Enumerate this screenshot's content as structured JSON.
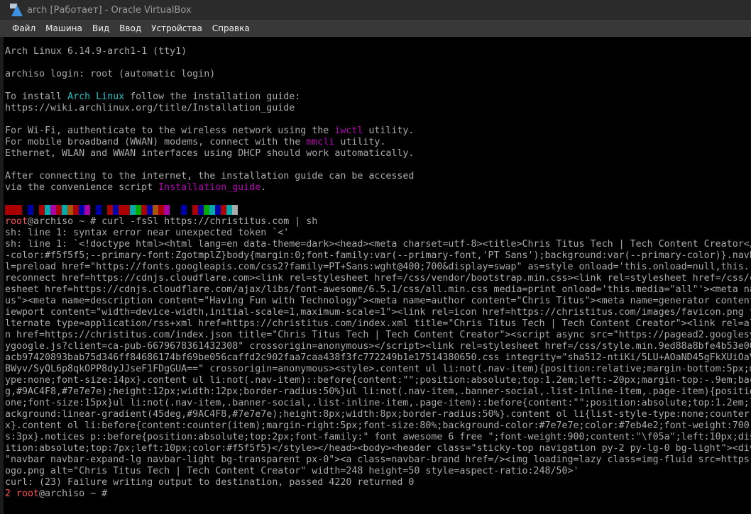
{
  "window": {
    "title": "arch [Работает] - Oracle VirtualBox",
    "menu": [
      "Файл",
      "Машина",
      "Вид",
      "Ввод",
      "Устройства",
      "Справка"
    ]
  },
  "colors": {
    "text": "#aaaaaa",
    "cyan": "#22c0c0",
    "magenta": "#b000b0",
    "prompt_red": "#ff5555",
    "palette": {
      "r": "#aa0000",
      "b": "#0000aa",
      "c": "#00aaaa",
      "m": "#aa00aa",
      "o": "#aa5500",
      "g": "#00aa00",
      "w": "#aaaaaa",
      "k": "#000000"
    }
  },
  "color_bar": [
    "r",
    "r",
    "r",
    "k",
    "b",
    "k",
    "r",
    "c",
    "m",
    "r",
    "c",
    "o",
    "r",
    "b",
    "m",
    "k",
    "b",
    "k",
    "r",
    "b",
    "r",
    "r",
    "c",
    "g",
    "r",
    "b",
    "o",
    "r",
    "m",
    "k",
    "k",
    "b",
    "k",
    "r",
    "b",
    "g",
    "c",
    "b",
    "r",
    "c",
    "w"
  ],
  "terminal": {
    "lines": [
      {
        "segments": [
          {
            "text": "Arch Linux 6.14.9-arch1-1 (tty1)"
          }
        ]
      },
      {
        "segments": []
      },
      {
        "segments": [
          {
            "text": "archiso login: root (automatic login)"
          }
        ]
      },
      {
        "segments": []
      },
      {
        "segments": [
          {
            "text": "To install "
          },
          {
            "text": "Arch Linux",
            "color": "cyan"
          },
          {
            "text": " follow the installation guide:"
          }
        ]
      },
      {
        "segments": [
          {
            "text": "https://wiki.archlinux.org/title/Installation_guide"
          }
        ]
      },
      {
        "segments": []
      },
      {
        "segments": [
          {
            "text": "For Wi-Fi, authenticate to the wireless network using the "
          },
          {
            "text": "iwctl",
            "color": "magenta"
          },
          {
            "text": " utility."
          }
        ]
      },
      {
        "segments": [
          {
            "text": "For mobile broadband (WWAN) modems, connect with the "
          },
          {
            "text": "mmcli",
            "color": "magenta"
          },
          {
            "text": " utility."
          }
        ]
      },
      {
        "segments": [
          {
            "text": "Ethernet, WLAN and WWAN interfaces using DHCP should work automatically."
          }
        ]
      },
      {
        "segments": []
      },
      {
        "segments": [
          {
            "text": "After connecting to the internet, the installation guide can be accessed"
          }
        ]
      },
      {
        "segments": [
          {
            "text": "via the convenience script "
          },
          {
            "text": "Installation_guide",
            "color": "magenta"
          },
          {
            "text": "."
          }
        ]
      },
      {
        "segments": []
      },
      {
        "colorbar": true,
        "segments": []
      },
      {
        "segments": [
          {
            "text": "root",
            "color": "prompt_red"
          },
          {
            "text": "@archiso ~ # curl -fsSl https://christitus.com | sh"
          }
        ]
      },
      {
        "segments": [
          {
            "text": "sh: line 1: syntax error near unexpected token `<'"
          }
        ]
      },
      {
        "segments": [
          {
            "text": "sh: line 1: `<!doctype html><html lang=en data-theme=dark><head><meta charset=utf-8><title>Chris Titus Tech | Tech Content Creator</"
          }
        ]
      },
      {
        "segments": [
          {
            "text": "-color:#f5f5f5;--primary-font:ZgotmplZ}body{margin:0;font-family:var(--primary-font,'PT Sans');background:var(--primary-color)}.navb"
          }
        ]
      },
      {
        "segments": [
          {
            "text": "l=preload href=\"https://fonts.googleapis.com/css2?family=PT+Sans:wght@400;700&display=swap\" as=style onload='this.onload=null,this.r"
          }
        ]
      },
      {
        "segments": [
          {
            "text": "reconnect href=https://cdnjs.cloudflare.com><link rel=stylesheet href=/css/vendor/bootstrap.min.css><link rel=stylesheet href=/css/c"
          }
        ]
      },
      {
        "segments": [
          {
            "text": "esheet href=https://cdnjs.cloudflare.com/ajax/libs/font-awesome/6.5.1/css/all.min.css media=print onload='this.media=\"all\"'><meta na"
          }
        ]
      },
      {
        "segments": [
          {
            "text": "us\"><meta name=description content=\"Having Fun with Technology\"><meta name=author content=\"Chris Titus\"><meta name=generator content"
          }
        ]
      },
      {
        "segments": [
          {
            "text": "iewport content=\"width=device-width,initial-scale=1,maximum-scale=1\"><link rel=icon href=https://christitus.com/images/favicon.png t"
          }
        ]
      },
      {
        "segments": [
          {
            "text": "lternate type=application/rss+xml href=https://christitus.com/index.xml title=\"Chris Titus Tech | Tech Content Creator\"><link rel=al"
          }
        ]
      },
      {
        "segments": [
          {
            "text": "n href=https://christitus.com/index.json title=\"Chris Titus Tech | Tech Content Creator\"><script async src=\"https://pagead2.googlesy"
          }
        ]
      },
      {
        "segments": [
          {
            "text": "ygoogle.js?client=ca-pub-6679678361432308\" crossorigin=anonymous></script><link rel=stylesheet href=/css/style.min.9ed88a8bfe4b53e00"
          }
        ]
      },
      {
        "segments": [
          {
            "text": "acb97420893bab75d346ff84686174bf69be056caffd2c902faa7caa438f3fc772249b1e17514380650.css integrity=\"sha512-ntiKi/5LU+AOaND45gFkXUiOaV"
          }
        ]
      },
      {
        "segments": [
          {
            "text": "BWyv/SyQL6p8qkOPP8dyJJseF1FDgGUA==\" crossorigin=anonymous><style>.content ul li:not(.nav-item){position:relative;margin-bottom:5px;m"
          }
        ]
      },
      {
        "segments": [
          {
            "text": "ype:none;font-size:14px}.content ul li:not(.nav-item)::before{content:\"\";position:absolute;top:1.2em;left:-20px;margin-top:-.9em;bac"
          }
        ]
      },
      {
        "segments": [
          {
            "text": "g,#9AC4F8,#7e7e7e);height:12px;width:12px;border-radius:50%}ul li:not(.nav-item,.banner-social,.list-inline-item,.page-item){positio"
          }
        ]
      },
      {
        "segments": [
          {
            "text": "one;font-size:15px}ul li:not(.nav-item,.banner-social,.list-inline-item,.page-item)::before{content:\"\";position:absolute;top:1.2em;l"
          }
        ]
      },
      {
        "segments": [
          {
            "text": "ackground:linear-gradient(45deg,#9AC4F8,#7e7e7e);height:8px;width:8px;border-radius:50%}.content ol li{list-style-type:none;counter-"
          }
        ]
      },
      {
        "segments": [
          {
            "text": "x}.content ol li:before{content:counter(item);margin-right:5px;font-size:80%;background-color:#7e7e7e;color:#7eb4e2;font-weight:700;"
          }
        ]
      },
      {
        "segments": [
          {
            "text": "s:3px}.notices p::before{position:absolute;top:2px;font-family:\" font awesome 6 free \";font-weight:900;content:\"\\f05a\";left:10px;dis"
          }
        ]
      },
      {
        "segments": [
          {
            "text": "ition:absolute;top:7px;left:10px;color:#f5f5f5}</style></head><body><header class=\"sticky-top navigation py-2 py-lg-0 bg-light\"><div"
          }
        ]
      },
      {
        "segments": [
          {
            "text": "\"navbar navbar-expand-lg navbar-light bg-transparent px-0\"><a class=navbar-brand href=/><img loading=lazy class=img-fluid src=https"
          }
        ]
      },
      {
        "segments": [
          {
            "text": "ogo.png alt=\"Chris Titus Tech | Tech Content Creator\" width=248 height=50 style=aspect-ratio:248/50>'"
          }
        ]
      },
      {
        "segments": [
          {
            "text": "curl: (23) Failure writing output to destination, passed 4220 returned 0"
          }
        ]
      },
      {
        "segments": [
          {
            "text": "2 root",
            "color": "prompt_red"
          },
          {
            "text": "@archiso ~ #"
          }
        ]
      }
    ]
  }
}
